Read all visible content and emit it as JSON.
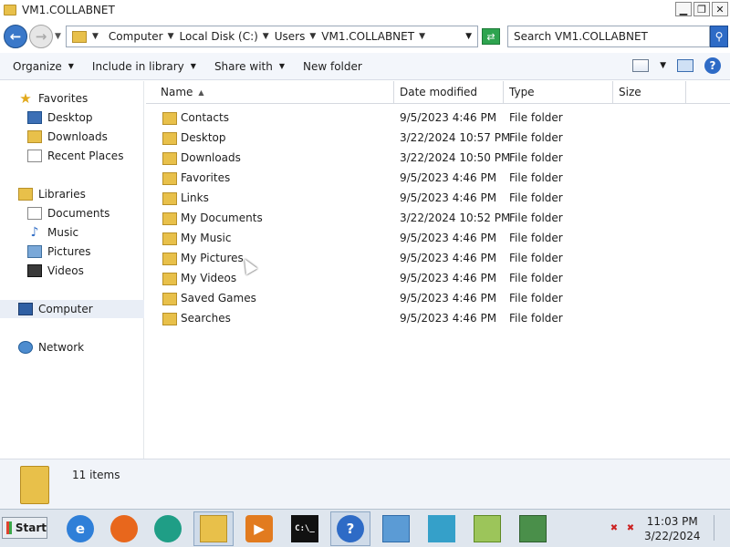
{
  "window": {
    "title": "VM1.COLLABNET",
    "minimize": "▁",
    "maximize": "❐",
    "close": "✕"
  },
  "address": {
    "crumbs": [
      "Computer",
      "Local Disk (C:)",
      "Users",
      "VM1.COLLABNET"
    ],
    "search_placeholder": "Search VM1.COLLABNET"
  },
  "toolbar": {
    "organize": "Organize",
    "include_in_library": "Include in library",
    "share_with": "Share with",
    "new_folder": "New folder"
  },
  "nav": {
    "favorites": "Favorites",
    "desktop": "Desktop",
    "downloads": "Downloads",
    "recent_places": "Recent Places",
    "libraries": "Libraries",
    "documents": "Documents",
    "music": "Music",
    "pictures": "Pictures",
    "videos": "Videos",
    "computer": "Computer",
    "network": "Network"
  },
  "columns": {
    "name": "Name",
    "date_modified": "Date modified",
    "type": "Type",
    "size": "Size"
  },
  "files": [
    {
      "name": "Contacts",
      "date": "9/5/2023 4:46 PM",
      "type": "File folder"
    },
    {
      "name": "Desktop",
      "date": "3/22/2024 10:57 PM",
      "type": "File folder"
    },
    {
      "name": "Downloads",
      "date": "3/22/2024 10:50 PM",
      "type": "File folder"
    },
    {
      "name": "Favorites",
      "date": "9/5/2023 4:46 PM",
      "type": "File folder"
    },
    {
      "name": "Links",
      "date": "9/5/2023 4:46 PM",
      "type": "File folder"
    },
    {
      "name": "My Documents",
      "date": "3/22/2024 10:52 PM",
      "type": "File folder"
    },
    {
      "name": "My Music",
      "date": "9/5/2023 4:46 PM",
      "type": "File folder"
    },
    {
      "name": "My Pictures",
      "date": "9/5/2023 4:46 PM",
      "type": "File folder"
    },
    {
      "name": "My Videos",
      "date": "9/5/2023 4:46 PM",
      "type": "File folder"
    },
    {
      "name": "Saved Games",
      "date": "9/5/2023 4:46 PM",
      "type": "File folder"
    },
    {
      "name": "Searches",
      "date": "9/5/2023 4:46 PM",
      "type": "File folder"
    }
  ],
  "details": {
    "count": "11 items"
  },
  "taskbar": {
    "start": "Start",
    "time": "11:03 PM",
    "date": "3/22/2024",
    "cmd_glyph": "C:\\_",
    "help_glyph": "?"
  }
}
